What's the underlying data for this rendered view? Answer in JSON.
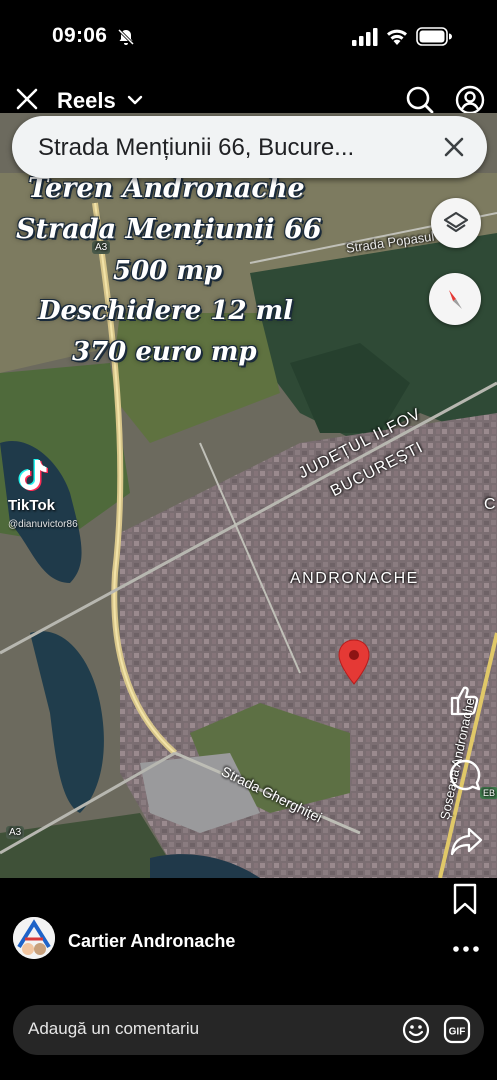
{
  "status_bar": {
    "time": "09:06"
  },
  "header": {
    "title": "Reels"
  },
  "map": {
    "search_text": "Strada Mențiunii 66, Bucure...",
    "labels": {
      "strada_popasul": "Strada Popasul",
      "judet": "JUDEȚUL ILFOV",
      "bucuresti": "BUCUREȘTI",
      "andronache": "ANDRONACHE",
      "gherghitei": "Strada Gherghiței",
      "soseaua": "Șoseaua Andronache",
      "a3_top": "A3",
      "a3_bottom": "A3",
      "eb": "EB",
      "c": "C"
    }
  },
  "overlay": {
    "line1": "Teren Andronache",
    "line2": "Strada Mențiunii 66",
    "line3": "500 mp",
    "line4": "Deschidere 12 ml",
    "line5": "370 euro mp"
  },
  "watermark": {
    "name": "TikTok",
    "handle": "@dianuvictor86"
  },
  "post": {
    "author": "Cartier Andronache"
  },
  "comment_bar": {
    "placeholder": "Adaugă un comentariu"
  },
  "colors": {
    "pin": "#e53935",
    "map_bg": "#6c6a62",
    "search_bg": "#f1f3f4"
  }
}
